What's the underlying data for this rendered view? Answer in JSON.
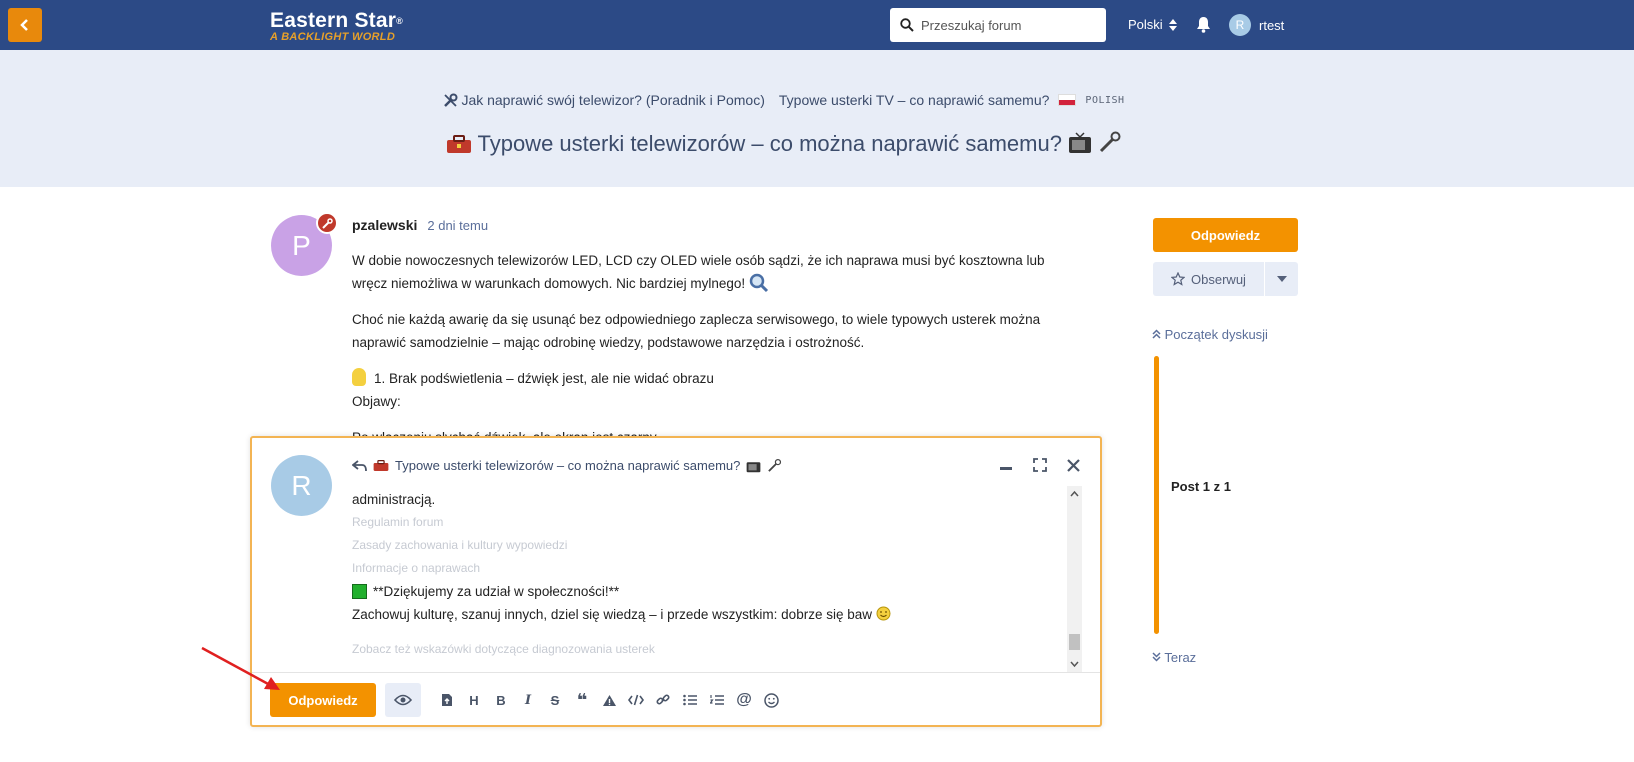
{
  "header": {
    "back_label": "‹",
    "logo_title": "Eastern Star",
    "logo_reg": "®",
    "logo_sub": "A BACKLIGHT WORLD",
    "search_placeholder": "Przeszukaj forum",
    "language": "Polski",
    "username": "rtest",
    "user_initial": "R"
  },
  "breadcrumbs": [
    {
      "label": "Jak naprawić swój telewizor? (Poradnik i Pomoc)"
    },
    {
      "label": "Typowe usterki TV – co naprawić samemu?"
    }
  ],
  "language_tag": "POLISH",
  "topic_title": "Typowe usterki telewizorów – co można naprawić samemu?",
  "post": {
    "avatar_initial": "P",
    "author": "pzalewski",
    "time": "2 dni temu",
    "paragraphs": [
      "W dobie nowoczesnych telewizorów LED, LCD czy OLED wiele osób sądzi, że ich naprawa musi być kosztowna lub wręcz niemożliwa w warunkach domowych. Nic bardziej mylnego!",
      "Choć nie każdą awarię da się usunąć bez odpowiedniego zaplecza serwisowego, to wiele typowych usterek można naprawić samodzielnie – mając odrobinę wiedzy, podstawowe narzędzia i ostrożność."
    ],
    "section_title": "1. Brak podświetlenia – dźwięk jest, ale nie widać obrazu",
    "objawy": "Objawy:",
    "partial_line": "Po włączeniu słychać dźwięk, ale ekran jest czarny."
  },
  "sidebar": {
    "reply_label": "Odpowiedz",
    "watch_label": "Obserwuj",
    "timeline_start": "Początek dyskusji",
    "post_position": "Post 1 z 1",
    "timeline_end": "Teraz"
  },
  "composer": {
    "avatar_initial": "R",
    "reply_title": "Typowe usterki telewizorów – co można naprawić samemu?",
    "line1": "administracją.",
    "ghost1": "Regulamin forum",
    "ghost2": "Zasady zachowania i kultury wypowiedzi",
    "ghost3": "Informacje o naprawach",
    "thanks": "**Dziękujemy za udział w społeczności!**",
    "closing": "Zachowuj kulturę, szanuj innych, dziel się wiedzą – i przede wszystkim: dobrze się baw",
    "ghost4": "Zobacz też wskazówki dotyczące diagnozowania usterek",
    "reply_label": "Odpowiedz"
  },
  "colors": {
    "header_bg": "#2c4a86",
    "accent": "#f39200",
    "hero_bg": "#e8edf7"
  }
}
